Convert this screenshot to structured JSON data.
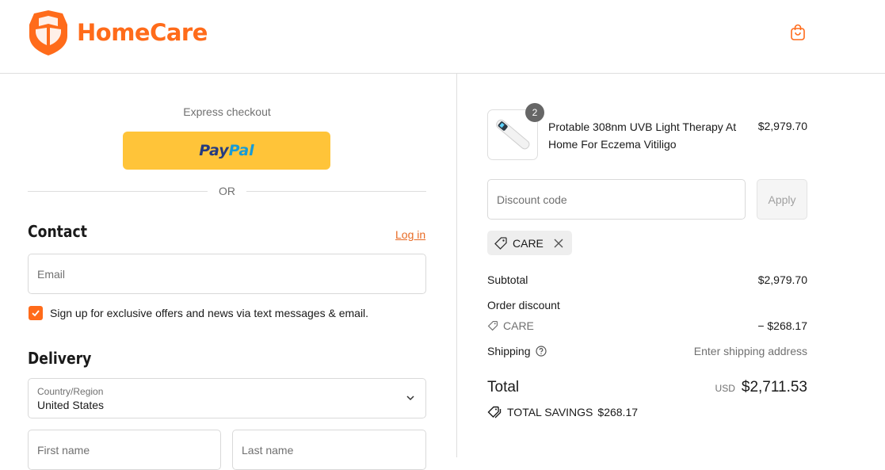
{
  "brand": {
    "name": "HomeCare",
    "color": "#ff6b1a"
  },
  "header": {
    "cart_icon": "shopping-bag-icon"
  },
  "checkout": {
    "express_label": "Express checkout",
    "paypal": {
      "part1": "Pay",
      "part2": "Pal"
    },
    "or_label": "OR",
    "contact": {
      "title": "Contact",
      "login_label": "Log in",
      "email_placeholder": "Email",
      "signup_label": "Sign up for exclusive offers and news via text messages & email.",
      "signup_checked": true
    },
    "delivery": {
      "title": "Delivery",
      "country_label": "Country/Region",
      "country_value": "United States",
      "first_name_placeholder": "First name",
      "last_name_placeholder": "Last name"
    }
  },
  "summary": {
    "product": {
      "name": "Protable 308nm UVB Light Therapy At Home For Eczema Vitiligo",
      "price": "$2,979.70",
      "quantity": "2"
    },
    "discount": {
      "placeholder": "Discount code",
      "apply_label": "Apply",
      "applied_code": "CARE"
    },
    "subtotal_label": "Subtotal",
    "subtotal_value": "$2,979.70",
    "order_discount_label": "Order discount",
    "order_discount_code": "CARE",
    "order_discount_value": "− $268.17",
    "shipping_label": "Shipping",
    "shipping_value": "Enter shipping address",
    "total_label": "Total",
    "currency": "USD",
    "total_value": "$2,711.53",
    "savings_label": "TOTAL SAVINGS",
    "savings_value": "$268.17"
  }
}
